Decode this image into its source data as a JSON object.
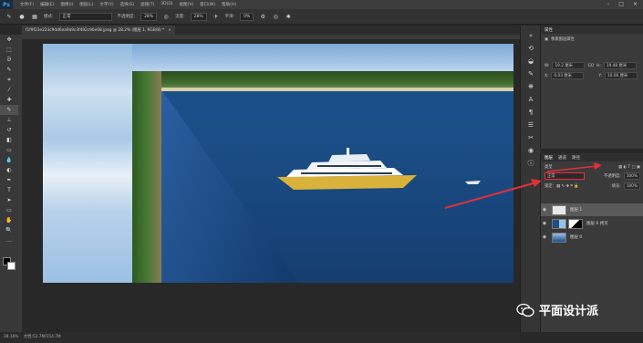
{
  "app": {
    "logo": "Ps"
  },
  "menu": [
    "文件(F)",
    "编辑(E)",
    "图像(I)",
    "图层(L)",
    "文字(Y)",
    "选择(S)",
    "滤镜(T)",
    "3D(D)",
    "视图(V)",
    "窗口(W)",
    "帮助(H)"
  ],
  "options": {
    "mode_label": "模式:",
    "mode_value": "正常",
    "opacity_label": "不透明度:",
    "opacity_value": "28%",
    "flow_label": "流量:",
    "flow_value": "28%",
    "smooth_label": "平滑:",
    "smooth_value": "0%"
  },
  "document_tab": {
    "title": "f1f9f23e223c9dd6ea9a9c3f492c96e08.jpeg @ 28.2% (图层 1, RGB/8) *",
    "close": "×"
  },
  "status_bar": {
    "zoom": "28.16%",
    "doc_info": "文档:52.7M/154.7M"
  },
  "properties_panel": {
    "title": "属性",
    "subtitle": "像素图层属性",
    "w_label": "W:",
    "w_value": "19.2 厘米",
    "h_label": "H:",
    "h_value": "19.48 厘米",
    "x_label": "X:",
    "x_value": "0.03 厘米",
    "y_label": "Y:",
    "y_value": "10.06 厘米",
    "link": "GO"
  },
  "layers_panel": {
    "tabs": [
      "图层",
      "通道",
      "路径"
    ],
    "filter_label": "类型",
    "blend_value": "正常",
    "opacity_label": "不透明度:",
    "opacity_value": "100%",
    "lock_label": "锁定:",
    "fill_label": "填充:",
    "fill_value": "100%",
    "layers": [
      {
        "name": "图层 1",
        "selected": true
      },
      {
        "name": "图层 0 拷贝",
        "selected": false
      },
      {
        "name": "图层 0",
        "selected": false
      }
    ]
  },
  "watermark": {
    "text": "平面设计派"
  },
  "colors": {
    "accent": "#31a8ff",
    "arrow": "#e0303a"
  }
}
